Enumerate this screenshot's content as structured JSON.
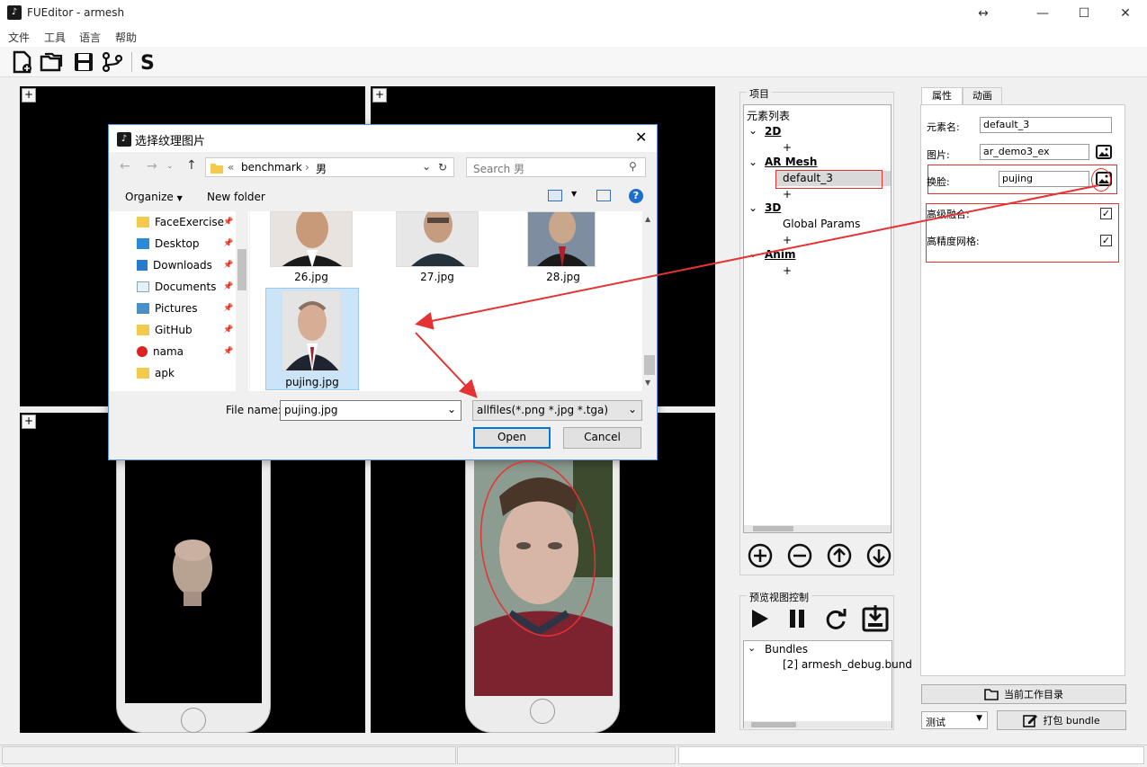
{
  "app": {
    "title": "FUEditor - armesh"
  },
  "window_controls": {
    "resize": "↔",
    "minimize": "—",
    "maximize": "☐",
    "close": "✕"
  },
  "menu": [
    "文件",
    "工具",
    "语言",
    "帮助"
  ],
  "toolbar": {
    "items": [
      "new-file-icon",
      "open-folder-icon",
      "save-icon",
      "branch-icon",
      "script-s-icon"
    ]
  },
  "viewports": {
    "plus": "+"
  },
  "project": {
    "group_label": "项目",
    "tree_root": "元素列表",
    "items": [
      {
        "kind": "section",
        "label": "2D",
        "caret": "⌄"
      },
      {
        "kind": "add",
        "label": "+"
      },
      {
        "kind": "section",
        "label": "AR Mesh",
        "caret": "⌄"
      },
      {
        "kind": "child",
        "label": "default_3"
      },
      {
        "kind": "add",
        "label": "+"
      },
      {
        "kind": "section",
        "label": "3D",
        "caret": "⌄"
      },
      {
        "kind": "child",
        "label": "Global Params"
      },
      {
        "kind": "add",
        "label": "+"
      },
      {
        "kind": "section",
        "label": "Anim",
        "caret": "⌄"
      },
      {
        "kind": "add",
        "label": "+"
      }
    ],
    "actions": [
      "add-circle-icon",
      "remove-circle-icon",
      "move-up-circle-icon",
      "move-down-circle-icon"
    ]
  },
  "preview": {
    "group_label": "预览视图控制",
    "buttons": [
      "play-icon",
      "pause-icon",
      "refresh-icon",
      "export-icon"
    ],
    "bundles_header": "Bundles",
    "bundle_item": "[2] armesh_debug.bund"
  },
  "props": {
    "tabs": [
      "属性",
      "动画"
    ],
    "element_name_label": "元素名:",
    "element_name_value": "default_3",
    "image_label": "图片:",
    "image_value": "ar_demo3_ex",
    "faceswap_label": "换脸:",
    "faceswap_value": "pujing",
    "advanced_blend_label": "高级融合:",
    "advanced_blend_checked": "✓",
    "hires_mesh_label": "高精度网格:",
    "hires_mesh_checked": "✓",
    "workdir_button": "当前工作目录",
    "mode_select": "测试",
    "pack_button": "打包 bundle"
  },
  "dialog": {
    "title": "选择纹理图片",
    "path_prefix": "«",
    "path_parts": [
      "benchmark",
      "男"
    ],
    "search_placeholder": "Search 男",
    "organize": "Organize",
    "new_folder": "New folder",
    "nav": [
      {
        "label": "FaceExercise",
        "icon": "folder"
      },
      {
        "label": "Desktop",
        "icon": "desktop"
      },
      {
        "label": "Downloads",
        "icon": "download"
      },
      {
        "label": "Documents",
        "icon": "document"
      },
      {
        "label": "Pictures",
        "icon": "pictures"
      },
      {
        "label": "GitHub",
        "icon": "folder"
      },
      {
        "label": "nama",
        "icon": "warning-folder"
      },
      {
        "label": "apk",
        "icon": "folder"
      }
    ],
    "files": [
      "26.jpg",
      "27.jpg",
      "28.jpg",
      "pujing.jpg"
    ],
    "filename_label": "File name:",
    "filename_value": "pujing.jpg",
    "filter_value": "allfiles(*.png *.jpg *.tga)",
    "open": "Open",
    "cancel": "Cancel"
  },
  "colors": {
    "annotation_red": "#e53333",
    "dialog_accent": "#0078d7",
    "viewport_bg": "#000000"
  }
}
